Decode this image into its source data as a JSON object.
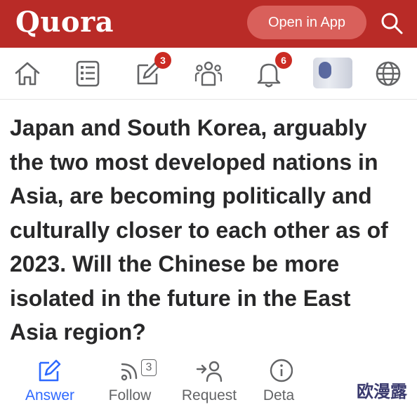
{
  "header": {
    "logo": "Quora",
    "open_in_app": "Open in App",
    "search_icon": "search-icon",
    "brand_color": "#b92b27"
  },
  "nav": {
    "items": [
      {
        "name": "home",
        "icon": "home-icon"
      },
      {
        "name": "following",
        "icon": "list-icon"
      },
      {
        "name": "answer",
        "icon": "edit-icon",
        "badge": "3"
      },
      {
        "name": "spaces",
        "icon": "people-icon"
      },
      {
        "name": "notifications",
        "icon": "bell-icon",
        "badge": "6"
      },
      {
        "name": "profile",
        "icon": "avatar"
      },
      {
        "name": "language",
        "icon": "globe-icon"
      }
    ]
  },
  "question": {
    "lines": [
      "Japan and South Korea, arguably",
      "the two most developed nations in",
      "Asia, are becoming politically and",
      "culturally closer to each other as of",
      "2023. Will the Chinese be more",
      "isolated in the future in the East",
      "Asia region?"
    ]
  },
  "actions": {
    "answer": "Answer",
    "follow": "Follow",
    "follow_count": "3",
    "request": "Request",
    "details": "Deta",
    "accent": "#2e69ff"
  },
  "watermark": "欧漫露"
}
